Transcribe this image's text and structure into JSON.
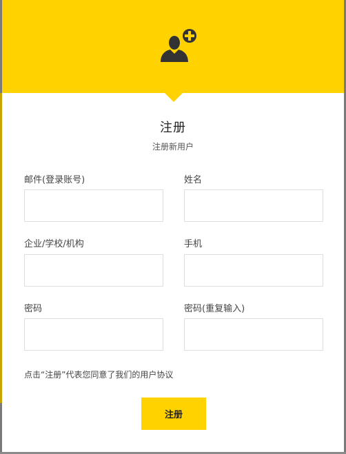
{
  "header": {
    "icon": "user-add-icon",
    "accent_color": "#ffd200"
  },
  "form": {
    "title": "注册",
    "subtitle": "注册新用户",
    "fields": [
      {
        "label": "邮件(登录账号)",
        "value": "",
        "placeholder": ""
      },
      {
        "label": "姓名",
        "value": "",
        "placeholder": ""
      },
      {
        "label": "企业/学校/机构",
        "value": "",
        "placeholder": ""
      },
      {
        "label": "手机",
        "value": "",
        "placeholder": ""
      },
      {
        "label": "密码",
        "value": "",
        "placeholder": ""
      },
      {
        "label": "密码(重复输入)",
        "value": "",
        "placeholder": ""
      }
    ],
    "agreement_text": "点击“注册”代表您同意了我们的用户协议",
    "submit_label": "注册"
  }
}
